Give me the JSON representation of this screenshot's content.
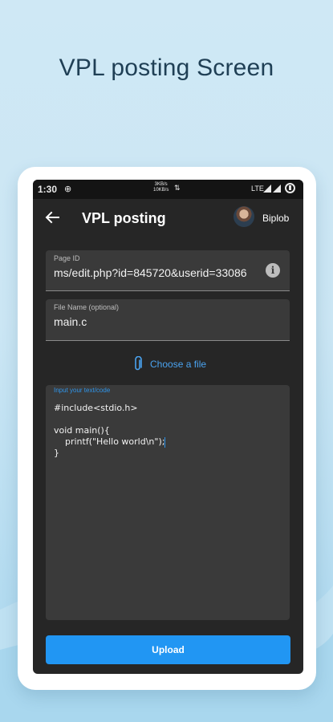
{
  "promo": {
    "headline": "VPL posting Screen"
  },
  "status_bar": {
    "time": "1:30",
    "speed_up": "3KB/s",
    "speed_down": "10KB/s",
    "network": "LTE"
  },
  "app_bar": {
    "title": "VPL posting",
    "user_name": "Biplob",
    "icons": {
      "back": "arrow-back-icon",
      "avatar": "avatar"
    }
  },
  "form": {
    "page_id": {
      "label": "Page ID",
      "value": "ms/edit.php?id=845720&userid=33086",
      "icon": "info-icon"
    },
    "file_name": {
      "label": "File Name (optional)",
      "value": "main.c"
    },
    "choose_file": {
      "label": "Choose a file",
      "icon": "paperclip-icon"
    },
    "code": {
      "label": "Input your text/code",
      "line1": "#include<stdio.h>",
      "line2": "",
      "line3": "void main(){",
      "line4": "    printf(\"Hello world\\n\");",
      "line5": "}"
    },
    "upload_button": "Upload"
  },
  "colors": {
    "accent": "#2196f3",
    "background_top": "#cfe8f5",
    "phone_bg": "#262626",
    "field_bg": "#3a3a3a"
  }
}
